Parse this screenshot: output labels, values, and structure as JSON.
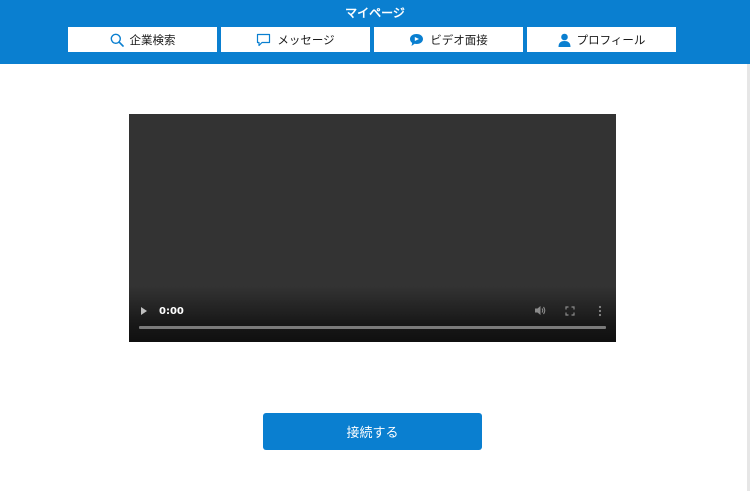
{
  "header": {
    "title": "マイページ",
    "nav": [
      {
        "label": "企業検索",
        "icon": "search-icon"
      },
      {
        "label": "メッセージ",
        "icon": "message-icon"
      },
      {
        "label": "ビデオ面接",
        "icon": "video-chat-icon"
      },
      {
        "label": "プロフィール",
        "icon": "user-icon"
      }
    ]
  },
  "video": {
    "time": "0:00",
    "progress": 0
  },
  "actions": {
    "connect_label": "接続する"
  },
  "colors": {
    "brand": "#0a7fd0",
    "video_bg": "#333333"
  }
}
